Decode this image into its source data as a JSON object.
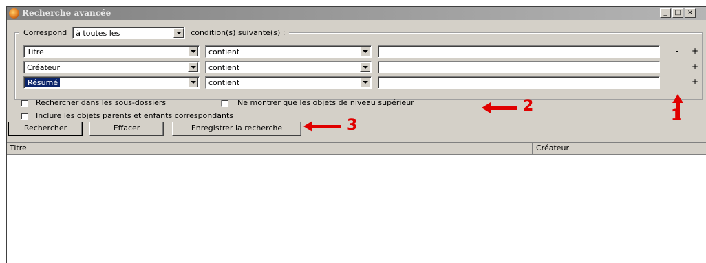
{
  "window": {
    "title": "Recherche avancée",
    "controls": [
      "_",
      "□",
      "×"
    ]
  },
  "match": {
    "label": "Correspond",
    "value": "à toutes les",
    "suffix": "condition(s) suivante(s) :"
  },
  "conditions": [
    {
      "field": "Titre",
      "operator": "contient",
      "value": "",
      "minus": "-",
      "plus": "+"
    },
    {
      "field": "Créateur",
      "operator": "contient",
      "value": "",
      "minus": "-",
      "plus": "+"
    },
    {
      "field": "Résumé",
      "operator": "contient",
      "value": "",
      "minus": "-",
      "plus": "+"
    }
  ],
  "options": {
    "subfolders": "Rechercher dans les sous-dossiers",
    "top_level": "Ne montrer que les objets de niveau supérieur",
    "parents_children": "Inclure les objets parents et enfants correspondants"
  },
  "buttons": {
    "search": "Rechercher",
    "clear": "Effacer",
    "save": "Enregistrer la recherche"
  },
  "results": {
    "columns": [
      "Titre",
      "Créateur"
    ]
  },
  "annotations": {
    "one": "1",
    "two": "2",
    "three": "3"
  },
  "colors": {
    "annotation": "#e00000",
    "selection": "#0a246a",
    "window_bg": "#d4d0c8"
  }
}
